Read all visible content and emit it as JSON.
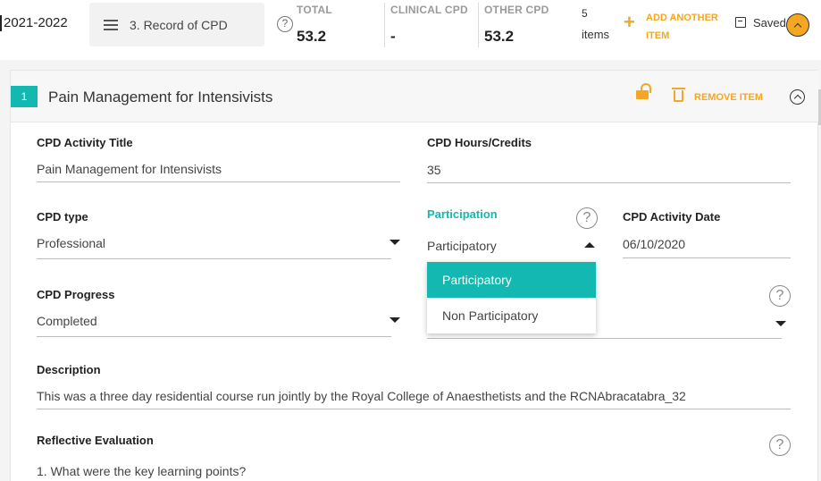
{
  "header": {
    "year": "2021-2022",
    "record_menu": "3. Record of CPD",
    "help_symbol": "?",
    "total_label": "TOTAL",
    "total_value": "53.2",
    "clinical_label": "CLINICAL CPD",
    "clinical_value": "-",
    "other_label": "OTHER CPD",
    "other_value": "53.2",
    "items_count": "5",
    "items_word": "items",
    "add_plus": "+",
    "add_another": "ADD ANOTHER ITEM",
    "saved_label": "Saved"
  },
  "item": {
    "number": "1",
    "title": "Pain Management for Intensivists",
    "remove_label": "REMOVE ITEM"
  },
  "form": {
    "activity_title_label": "CPD Activity Title",
    "activity_title_value": "Pain Management for Intensivists",
    "hours_label": "CPD Hours/Credits",
    "hours_value": "35",
    "type_label": "CPD type",
    "type_value": "Professional",
    "participation_label": "Participation",
    "participation_value": "Participatory",
    "participation_options": [
      "Participatory",
      "Non Participatory"
    ],
    "date_label": "CPD Activity Date",
    "date_value": "06/10/2020",
    "progress_label": "CPD Progress",
    "progress_value": "Completed",
    "description_label": "Description",
    "description_value": "This was a three day residential course run jointly by the Royal College of Anaesthetists and the RCNAbracatabra_32",
    "reflective_label": "Reflective Evaluation",
    "reflective_q1": "1. What were the key learning points?"
  },
  "colors": {
    "accent_teal": "#13b8b0",
    "accent_orange": "#f5a623"
  }
}
